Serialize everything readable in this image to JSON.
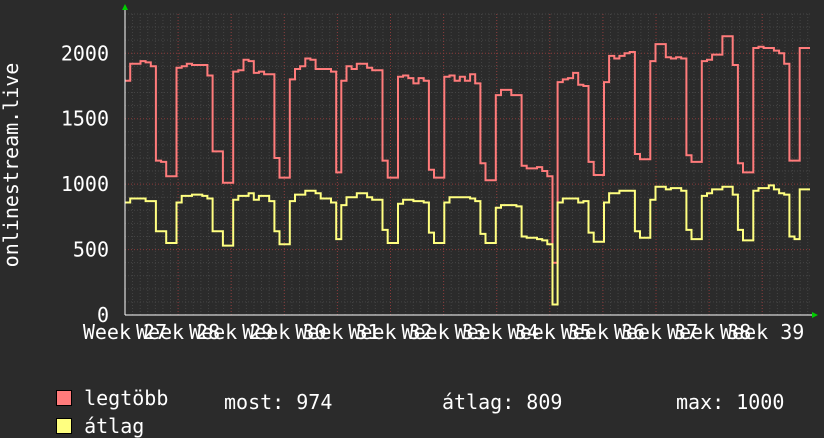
{
  "colors": {
    "background": "#2b2b2b",
    "plot_background": "#2b2b2b",
    "grid_minor": "#444444",
    "grid_major": "#8a3a3a",
    "axis": "#ffffff",
    "arrow": "#00cc00",
    "series_max": "#ff7b7b",
    "series_avg": "#ffff80"
  },
  "chart_data": {
    "type": "line",
    "ylabel": "onlinestream.live",
    "ylim": [
      0,
      2300
    ],
    "yticks": [
      0,
      500,
      1000,
      1500,
      2000
    ],
    "xtick_labels": [
      "Week 27",
      "Week 28",
      "Week 29",
      "Week 30",
      "Week 31",
      "Week 32",
      "Week 33",
      "Week 34",
      "Week 35",
      "Week 36",
      "Week 37",
      "Week 38",
      "Week 39"
    ],
    "grid": true,
    "legend_position": "bottom-left",
    "series": [
      {
        "name": "legtöbb",
        "color": "#ff7b7b",
        "values": [
          1790,
          1920,
          1920,
          1940,
          1930,
          1900,
          1180,
          1170,
          1060,
          1060,
          1890,
          1900,
          1920,
          1910,
          1910,
          1910,
          1830,
          1250,
          1250,
          1010,
          1010,
          1860,
          1870,
          1950,
          1940,
          1850,
          1860,
          1840,
          1840,
          1200,
          1050,
          1050,
          1800,
          1880,
          1900,
          1960,
          1950,
          1880,
          1880,
          1880,
          1860,
          1090,
          1790,
          1900,
          1880,
          1920,
          1920,
          1890,
          1870,
          1870,
          1180,
          1050,
          1050,
          1820,
          1830,
          1810,
          1770,
          1810,
          1790,
          1110,
          1050,
          1050,
          1820,
          1830,
          1790,
          1820,
          1790,
          1840,
          1770,
          1160,
          1030,
          1030,
          1680,
          1720,
          1720,
          1680,
          1680,
          1140,
          1120,
          1120,
          1130,
          1100,
          1060,
          400,
          1780,
          1800,
          1810,
          1850,
          1760,
          1750,
          1170,
          1070,
          1070,
          1780,
          1980,
          1960,
          1980,
          2000,
          2010,
          1230,
          1190,
          1190,
          1940,
          2070,
          2070,
          1970,
          1960,
          1970,
          1960,
          1220,
          1170,
          1170,
          1940,
          1950,
          1990,
          1990,
          2130,
          2130,
          1910,
          1160,
          1090,
          1090,
          2040,
          2050,
          2040,
          2040,
          2020,
          2000,
          1920,
          1180,
          1180,
          2040,
          2040
        ]
      },
      {
        "name": "átlag",
        "color": "#ffff80",
        "values": [
          860,
          890,
          890,
          890,
          870,
          870,
          640,
          640,
          550,
          550,
          860,
          910,
          910,
          920,
          920,
          910,
          890,
          640,
          640,
          530,
          530,
          880,
          910,
          910,
          930,
          880,
          910,
          910,
          870,
          640,
          540,
          540,
          870,
          920,
          920,
          950,
          950,
          930,
          890,
          890,
          860,
          580,
          840,
          900,
          900,
          930,
          930,
          900,
          880,
          880,
          650,
          550,
          550,
          850,
          880,
          880,
          870,
          870,
          860,
          630,
          550,
          550,
          860,
          900,
          900,
          900,
          900,
          890,
          870,
          620,
          550,
          550,
          820,
          840,
          840,
          840,
          830,
          600,
          590,
          590,
          580,
          570,
          540,
          80,
          860,
          890,
          890,
          890,
          860,
          870,
          630,
          560,
          560,
          860,
          930,
          930,
          950,
          950,
          950,
          640,
          590,
          590,
          880,
          980,
          980,
          960,
          970,
          970,
          950,
          650,
          580,
          580,
          910,
          930,
          960,
          960,
          980,
          980,
          920,
          650,
          570,
          570,
          950,
          970,
          970,
          990,
          960,
          930,
          920,
          600,
          580,
          960,
          960
        ]
      }
    ]
  },
  "legend": {
    "max_label": "legtöbb",
    "avg_label": "átlag"
  },
  "stats": {
    "current": "most: 974",
    "average": "átlag: 809",
    "maximum": "max: 1000"
  }
}
